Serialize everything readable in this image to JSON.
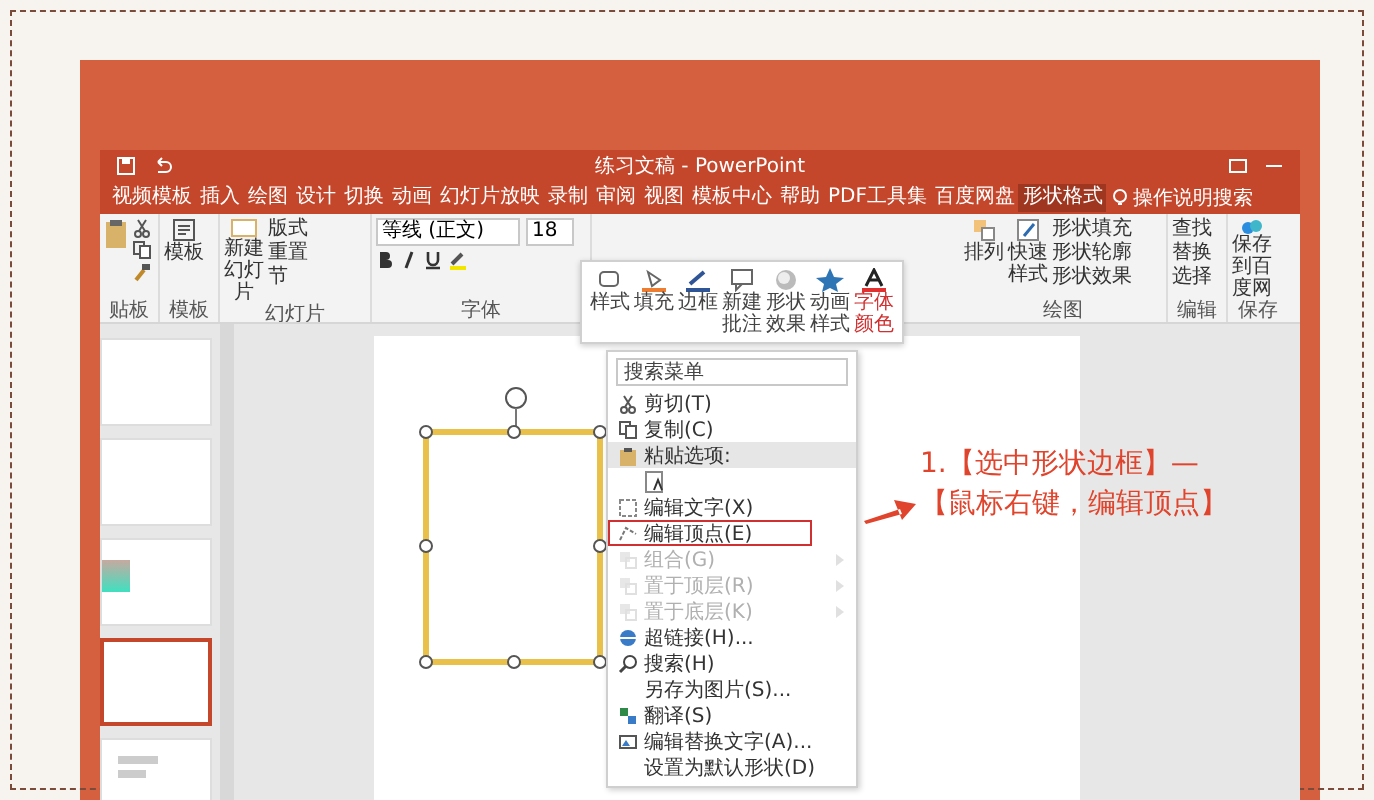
{
  "window": {
    "title": "练习文稿 - PowerPoint"
  },
  "tabs": [
    {
      "label": "视频模板",
      "selected": false
    },
    {
      "label": "插入",
      "selected": false
    },
    {
      "label": "绘图",
      "selected": false
    },
    {
      "label": "设计",
      "selected": false
    },
    {
      "label": "切换",
      "selected": false
    },
    {
      "label": "动画",
      "selected": false
    },
    {
      "label": "幻灯片放映",
      "selected": false
    },
    {
      "label": "录制",
      "selected": false
    },
    {
      "label": "审阅",
      "selected": false
    },
    {
      "label": "视图",
      "selected": false
    },
    {
      "label": "模板中心",
      "selected": false
    },
    {
      "label": "帮助",
      "selected": false
    },
    {
      "label": "PDF工具集",
      "selected": false
    },
    {
      "label": "百度网盘",
      "selected": false
    },
    {
      "label": "形状格式",
      "selected": true
    }
  ],
  "tell_me": {
    "placeholder": "操作说明搜索"
  },
  "ribbon": {
    "clipboard": {
      "label": "贴板"
    },
    "template": {
      "button": "模板",
      "label": "模板"
    },
    "slides": {
      "new_slide": "新建幻灯片",
      "layout": "版式",
      "reset": "重置",
      "section": "节",
      "label": "幻灯片"
    },
    "font": {
      "font_name": "等线 (正文)",
      "font_size": "18",
      "label": "字体"
    },
    "drawing": {
      "arrange": "排列",
      "quick_styles": "快速样式",
      "fill": "形状填充",
      "outline": "形状轮廓",
      "effects": "形状效果",
      "label": "绘图"
    },
    "editing": {
      "find": "查找",
      "replace": "替换",
      "select": "选择",
      "label": "编辑"
    },
    "save": {
      "button": "保存到百度网",
      "label": "保存"
    }
  },
  "mini_toolbar": [
    {
      "label": "样式"
    },
    {
      "label": "填充"
    },
    {
      "label": "边框"
    },
    {
      "label": "新建批注"
    },
    {
      "label": "形状效果"
    },
    {
      "label": "动画样式"
    },
    {
      "label": "字体颜色"
    }
  ],
  "slide_thumbnails": [
    {
      "kind": "blank",
      "selected": false
    },
    {
      "kind": "blank",
      "selected": false
    },
    {
      "kind": "gradient",
      "selected": false
    },
    {
      "kind": "blank",
      "selected": true
    },
    {
      "kind": "text",
      "selected": false
    }
  ],
  "context_menu": {
    "search": {
      "placeholder": "搜索菜单"
    },
    "items": [
      {
        "label": "剪切(T)",
        "disabled": false,
        "highlighted": false,
        "outlined": false,
        "submenu": false
      },
      {
        "label": "复制(C)",
        "disabled": false,
        "highlighted": false,
        "outlined": false,
        "submenu": false
      },
      {
        "label": "粘贴选项:",
        "disabled": false,
        "highlighted": true,
        "outlined": false,
        "submenu": false
      },
      {
        "kind": "paste_option",
        "disabled": false,
        "highlighted": false,
        "outlined": false,
        "submenu": false
      },
      {
        "label": "编辑文字(X)",
        "disabled": false,
        "highlighted": false,
        "outlined": false,
        "submenu": false
      },
      {
        "label": "编辑顶点(E)",
        "disabled": false,
        "highlighted": false,
        "outlined": true,
        "submenu": false
      },
      {
        "label": "组合(G)",
        "disabled": true,
        "highlighted": false,
        "outlined": false,
        "submenu": true
      },
      {
        "label": "置于顶层(R)",
        "disabled": true,
        "highlighted": false,
        "outlined": false,
        "submenu": true
      },
      {
        "label": "置于底层(K)",
        "disabled": true,
        "highlighted": false,
        "outlined": false,
        "submenu": true
      },
      {
        "label": "超链接(H)...",
        "disabled": false,
        "highlighted": false,
        "outlined": false,
        "submenu": false
      },
      {
        "label": "搜索(H)",
        "disabled": false,
        "highlighted": false,
        "outlined": false,
        "submenu": false
      },
      {
        "label": "另存为图片(S)...",
        "disabled": false,
        "highlighted": false,
        "outlined": false,
        "submenu": false
      },
      {
        "label": "翻译(S)",
        "disabled": false,
        "highlighted": false,
        "outlined": false,
        "submenu": false
      },
      {
        "label": "编辑替换文字(A)...",
        "disabled": false,
        "highlighted": false,
        "outlined": false,
        "submenu": false
      },
      {
        "label": "设置为默认形状(D)",
        "disabled": false,
        "highlighted": false,
        "outlined": false,
        "submenu": false
      }
    ]
  },
  "annotation": {
    "lines": [
      "1.【选中形状边框】—",
      "【鼠标右键，编辑顶点】"
    ]
  }
}
